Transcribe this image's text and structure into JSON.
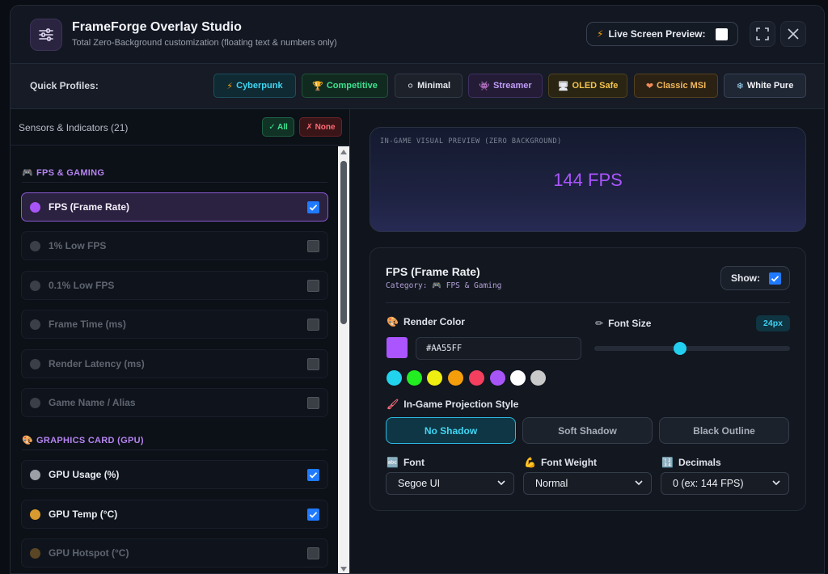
{
  "app": {
    "title": "FrameForge Overlay Studio",
    "subtitle": "Total Zero-Background customization (floating text & numbers only)",
    "logo_icon": "sliders-icon",
    "live_preview_icon": "⚡",
    "live_preview_label": "Live Screen Preview:",
    "live_preview_checked": false
  },
  "profiles": {
    "label": "Quick Profiles:",
    "items": [
      {
        "icon": "⚡",
        "label": "Cyberpunk",
        "color": "#3fd6f3"
      },
      {
        "icon": "🏆",
        "label": "Competitive",
        "color": "#3ee28f"
      },
      {
        "icon": "⚪",
        "label": "Minimal",
        "color": "#e6e8ee"
      },
      {
        "icon": "👾",
        "label": "Streamer",
        "color": "#c09cf5"
      },
      {
        "icon": "🖥",
        "label": "OLED Safe",
        "color": "#f4c34a"
      },
      {
        "icon": "❤",
        "label": "Classic MSI",
        "color": "#f2b85a"
      },
      {
        "icon": "❄",
        "label": "White Pure",
        "color": "#f2f3f7"
      }
    ]
  },
  "sensors": {
    "title": "Sensors & Indicators (21)",
    "all_label": "✓ All",
    "none_label": "✗ None",
    "categories": [
      {
        "icon": "🎮",
        "name": "FPS & GAMING",
        "items": [
          {
            "label": "FPS (Frame Rate)",
            "checked": true,
            "active": true,
            "dot": "#a855f7"
          },
          {
            "label": "1% Low FPS",
            "checked": false,
            "active": false,
            "dot": "#3b3f47"
          },
          {
            "label": "0.1% Low FPS",
            "checked": false,
            "active": false,
            "dot": "#3b3f47"
          },
          {
            "label": "Frame Time (ms)",
            "checked": false,
            "active": false,
            "dot": "#3b3f47"
          },
          {
            "label": "Render Latency (ms)",
            "checked": false,
            "active": false,
            "dot": "#3b3f47"
          },
          {
            "label": "Game Name / Alias",
            "checked": false,
            "active": false,
            "dot": "#3b3f47"
          }
        ]
      },
      {
        "icon": "🎨",
        "name": "GRAPHICS CARD (GPU)",
        "items": [
          {
            "label": "GPU Usage (%)",
            "checked": true,
            "active": false,
            "dot": "#9ca0a6"
          },
          {
            "label": "GPU Temp (°C)",
            "checked": true,
            "active": false,
            "dot": "#d69a2e"
          },
          {
            "label": "GPU Hotspot (°C)",
            "checked": false,
            "active": false,
            "dot": "#5a4524"
          }
        ]
      }
    ]
  },
  "preview": {
    "caption": "IN-GAME VISUAL PREVIEW (ZERO BACKGROUND)",
    "value": "144 FPS"
  },
  "settings": {
    "title": "FPS (Frame Rate)",
    "category": "Category: 🎮 FPS & Gaming",
    "show_label": "Show:",
    "show_checked": true,
    "render_color_label": "Render Color",
    "render_color_icon": "🎨",
    "color_hex": "#AA55FF",
    "preset_colors": [
      "#22d3ee",
      "#22ee22",
      "#eeee11",
      "#f59e0b",
      "#f43f5e",
      "#a855f7",
      "#ffffff",
      "#c9c9c9"
    ],
    "font_size_label": "Font Size",
    "font_size_icon": "✏",
    "font_size_value": "24px",
    "font_size_fraction": 0.44,
    "projection_label": "In-Game Projection Style",
    "projection_icon": "🖌",
    "projection_options": [
      "No Shadow",
      "Soft Shadow",
      "Black Outline"
    ],
    "projection_selected": 0,
    "font_label": "Font",
    "font_icon": "🔤",
    "font_value": "Segoe UI",
    "weight_label": "Font Weight",
    "weight_icon": "💪",
    "weight_value": "Normal",
    "decimals_label": "Decimals",
    "decimals_icon": "🔢",
    "decimals_value": "0 (ex: 144 FPS)"
  }
}
